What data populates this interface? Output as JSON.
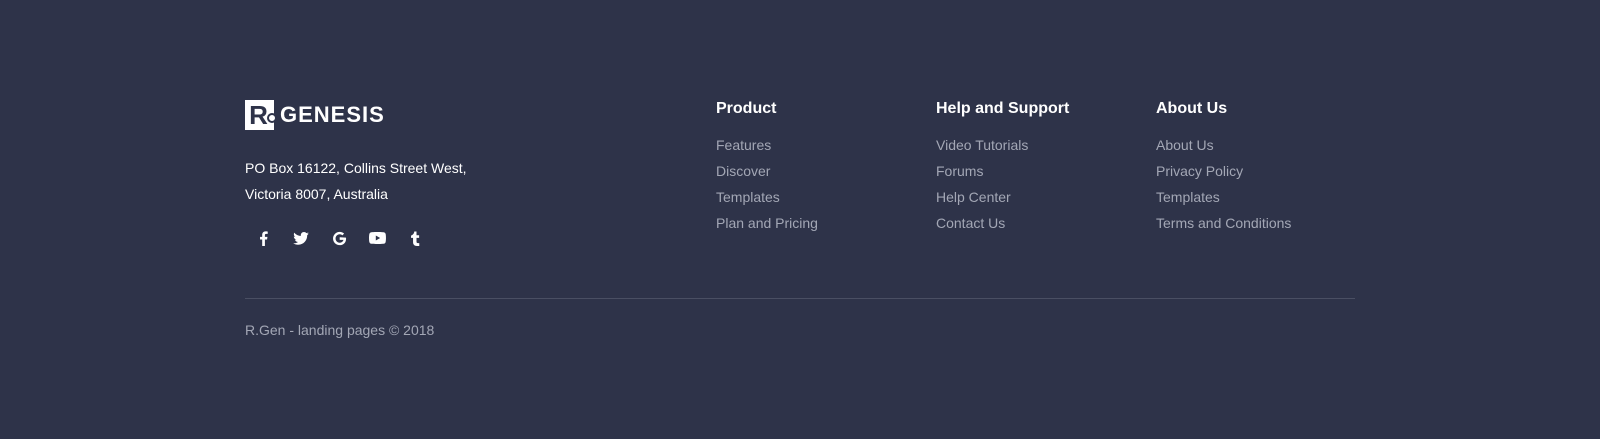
{
  "brand": {
    "logo_letter": "R",
    "logo_text": "GENESIS",
    "address_line1": "PO Box 16122, Collins Street West,",
    "address_line2": "Victoria 8007, Australia"
  },
  "social": [
    {
      "icon": "facebook-icon"
    },
    {
      "icon": "twitter-icon"
    },
    {
      "icon": "google-icon"
    },
    {
      "icon": "youtube-icon"
    },
    {
      "icon": "tumblr-icon"
    }
  ],
  "columns": {
    "product": {
      "title": "Product",
      "links": [
        "Features",
        "Discover",
        "Templates",
        "Plan and Pricing"
      ]
    },
    "help": {
      "title": "Help and Support",
      "links": [
        "Video Tutorials",
        "Forums",
        "Help Center",
        "Contact Us"
      ]
    },
    "about": {
      "title": "About Us",
      "links": [
        "About Us",
        "Privacy Policy",
        "Templates",
        "Terms and Conditions"
      ]
    }
  },
  "copyright": "R.Gen - landing pages © 2018",
  "colors": {
    "background": "#2e3349",
    "heading": "#ffffff",
    "link": "#a3a7b5",
    "divider": "#4a4f63"
  }
}
